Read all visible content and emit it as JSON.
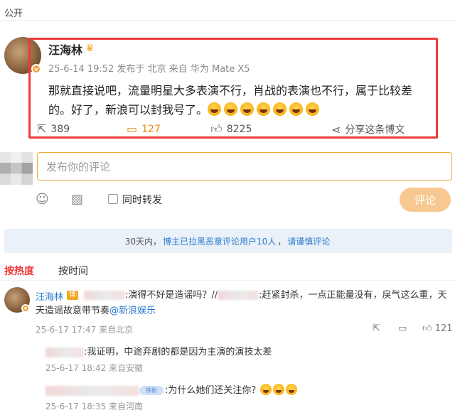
{
  "header": {
    "visibility": "公开"
  },
  "post": {
    "author": "汪海林",
    "crown_icon": "crown-icon",
    "meta": "25-6-14 19:52  发布于 北京  来自 华为 Mate X5",
    "text": "那就直接说吧，流量明星大多表演不行，肖战的表演也不行，属于比较差的。好了，新浪可以封我号了。",
    "emoji_count": 7,
    "reposts": "389",
    "comments": "127",
    "likes": "8225",
    "share_label": "分享这条博文",
    "highlight_color": "#ee3a3a"
  },
  "composer": {
    "placeholder": "发布你的评论",
    "forward_label": "同时转发",
    "submit_label": "评论",
    "accent": "#f0a63a"
  },
  "notice": {
    "prefix": "30天内，",
    "link1": "博主已拉黑恶意评论用户10人",
    "sep": "，",
    "link2": "请谨慎评论"
  },
  "tabs": {
    "hot": "按热度",
    "time": "按时间"
  },
  "comments": [
    {
      "author": "汪海林",
      "badge": "博主",
      "text_a": ":演得不好是造谣吗？//",
      "text_b": ":赶紧封杀，一点正能量没有，戾气这么重，天天造谣故意带节奏",
      "mention": "@新浪娱乐",
      "meta": "25-6-17 17:47 来自北京",
      "likes": "121"
    }
  ],
  "replies": [
    {
      "text": ":我证明，中途弃剧的都是因为主演的演技太差",
      "meta": "25-6-17 18:42 来自安徽"
    },
    {
      "level": "铁粉",
      "text": ":为什么她们还关注你？",
      "meta": "25-6-17 18:35 来自河南"
    }
  ]
}
